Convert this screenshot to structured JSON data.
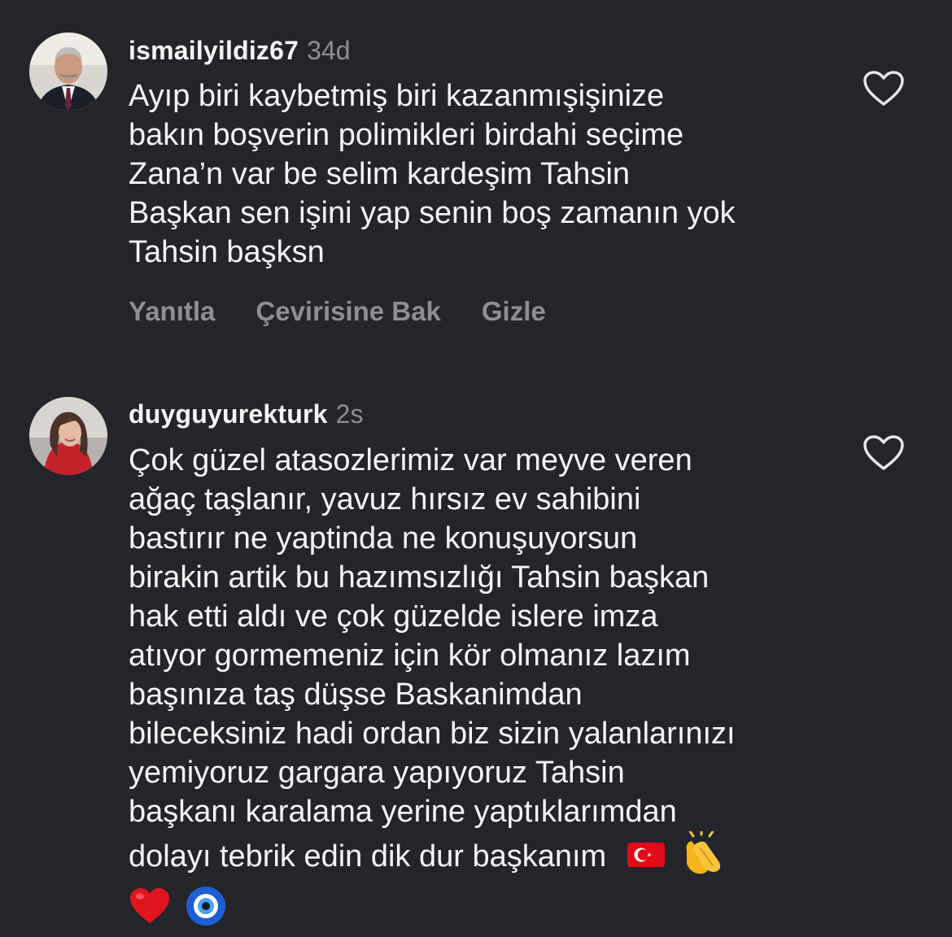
{
  "comments": [
    {
      "username": "ismailyildiz67",
      "time": "34d",
      "lines": [
        "Ayıp biri kaybetmiş biri kazanmışişinize",
        "bakın boşverin polimikleri birdahi seçime",
        "Zana’n var be selim kardeşim Tahsin",
        "Başkan sen işini yap senin boş zamanın yok",
        "Tahsin başksn"
      ],
      "actions": [
        "Yanıtla",
        "Çevirisine Bak",
        "Gizle"
      ],
      "like_icon": "heart-outline-icon"
    },
    {
      "username": "duyguyurekturk",
      "time": "2s",
      "lines": [
        "Çok güzel atasozlerimiz var meyve veren",
        "ağaç taşlanır, yavuz hırsız ev sahibini",
        "bastırır ne yaptinda ne konuşuyorsun",
        "birakin artik bu hazımsızlığı Tahsin başkan",
        "hak etti aldı ve çok güzelde islere imza",
        "atıyor gormemeniz için kör olmanız lazım",
        "başınıza taş düşse Baskanimdan",
        "bileceksiniz hadi ordan biz sizin yalanlarınızı",
        "yemiyoruz gargara yapıyoruz Tahsin",
        "başkanı karalama yerine yaptıklarımdan",
        "dolayı tebrik edin dik dur başkanım"
      ],
      "emojis_inline": [
        "turkish-flag",
        "clapping-hands"
      ],
      "emojis_last_line": [
        "red-heart",
        "nazar-amulet"
      ],
      "like_icon": "heart-outline-icon"
    }
  ],
  "colors": {
    "background": "#23252a",
    "text": "#f5f5f5",
    "muted": "#8e8e93"
  }
}
